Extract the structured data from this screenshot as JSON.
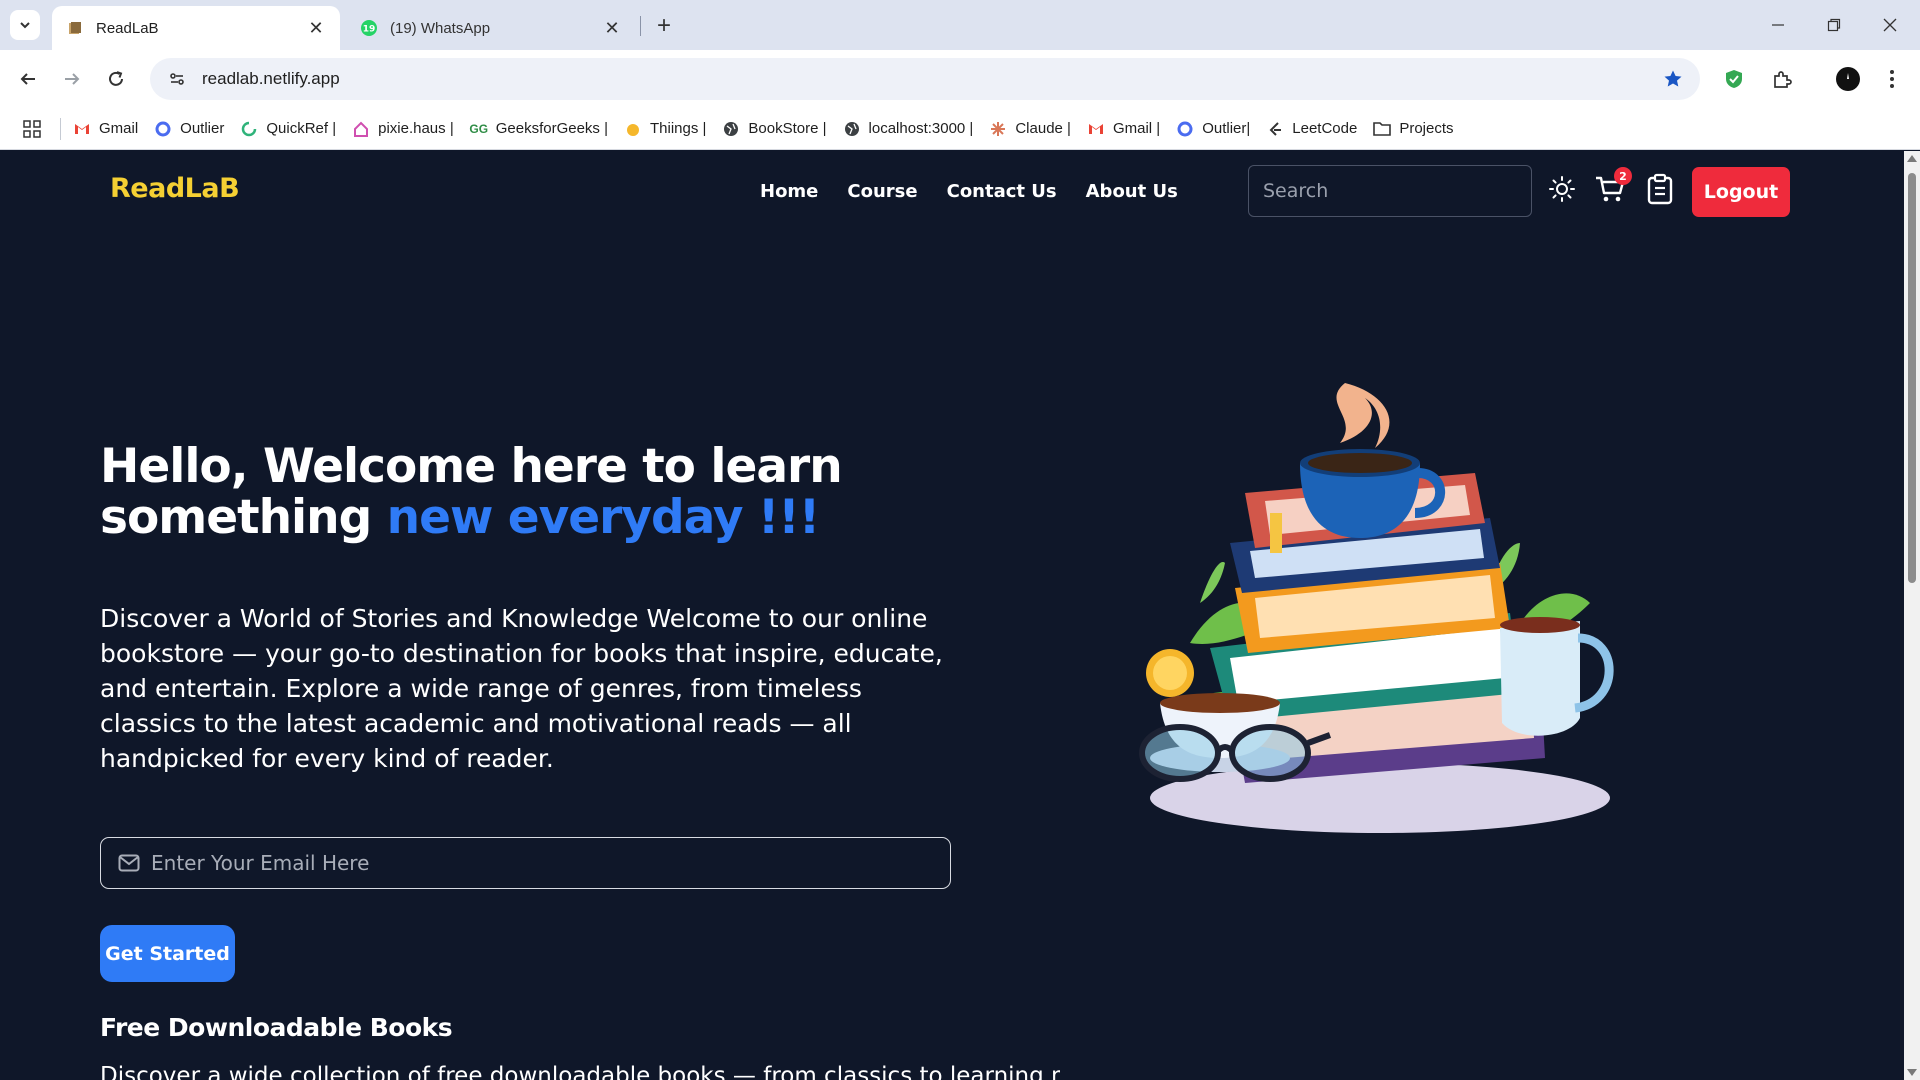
{
  "browser": {
    "tabs": [
      {
        "title": "ReadLaB",
        "active": true
      },
      {
        "title": "(19) WhatsApp",
        "active": false,
        "badge": "19"
      }
    ],
    "url": "readlab.netlify.app",
    "bookmarks": [
      {
        "label": "Gmail",
        "icon": "gmail-icon"
      },
      {
        "label": "Outlier",
        "icon": "outlier-icon"
      },
      {
        "label": "QuickRef |",
        "icon": "quickref-icon"
      },
      {
        "label": "pixie.haus |",
        "icon": "pixie-icon"
      },
      {
        "label": "GeeksforGeeks |",
        "icon": "gfg-icon"
      },
      {
        "label": "Thiings |",
        "icon": "thiings-icon"
      },
      {
        "label": "BookStore |",
        "icon": "globe-icon"
      },
      {
        "label": "localhost:3000 |",
        "icon": "globe-icon"
      },
      {
        "label": "Claude |",
        "icon": "claude-icon"
      },
      {
        "label": "Gmail |",
        "icon": "gmail-icon"
      },
      {
        "label": "Outlier|",
        "icon": "outlier-icon"
      },
      {
        "label": "LeetCode",
        "icon": "leetcode-icon"
      },
      {
        "label": "Projects",
        "icon": "folder-icon"
      }
    ]
  },
  "site": {
    "logo": "ReadLaB",
    "nav": [
      "Home",
      "Course",
      "Contact Us",
      "About Us"
    ],
    "search_placeholder": "Search",
    "cart_count": "2",
    "logout_label": "Logout"
  },
  "hero": {
    "title_line1": "Hello, Welcome here to learn",
    "title_line2_plain": "something ",
    "title_line2_accent": "new everyday !!!",
    "description": "Discover a World of Stories and Knowledge Welcome to our online bookstore — your go-to destination for books that inspire, educate, and entertain. Explore a wide range of genres, from timeless classics to the latest academic and motivational reads — all handpicked for every kind of reader.",
    "email_placeholder": "Enter Your Email Here",
    "cta_label": "Get Started",
    "free_title": "Free Downloadable Books",
    "free_desc": "Discover a wide collection of free downloadable books — from classics to learning materials"
  },
  "colors": {
    "background": "#0f1729",
    "accent_blue": "#2f7bf6",
    "logo_yellow": "#f5d033",
    "logout_red": "#ef2b3c"
  }
}
